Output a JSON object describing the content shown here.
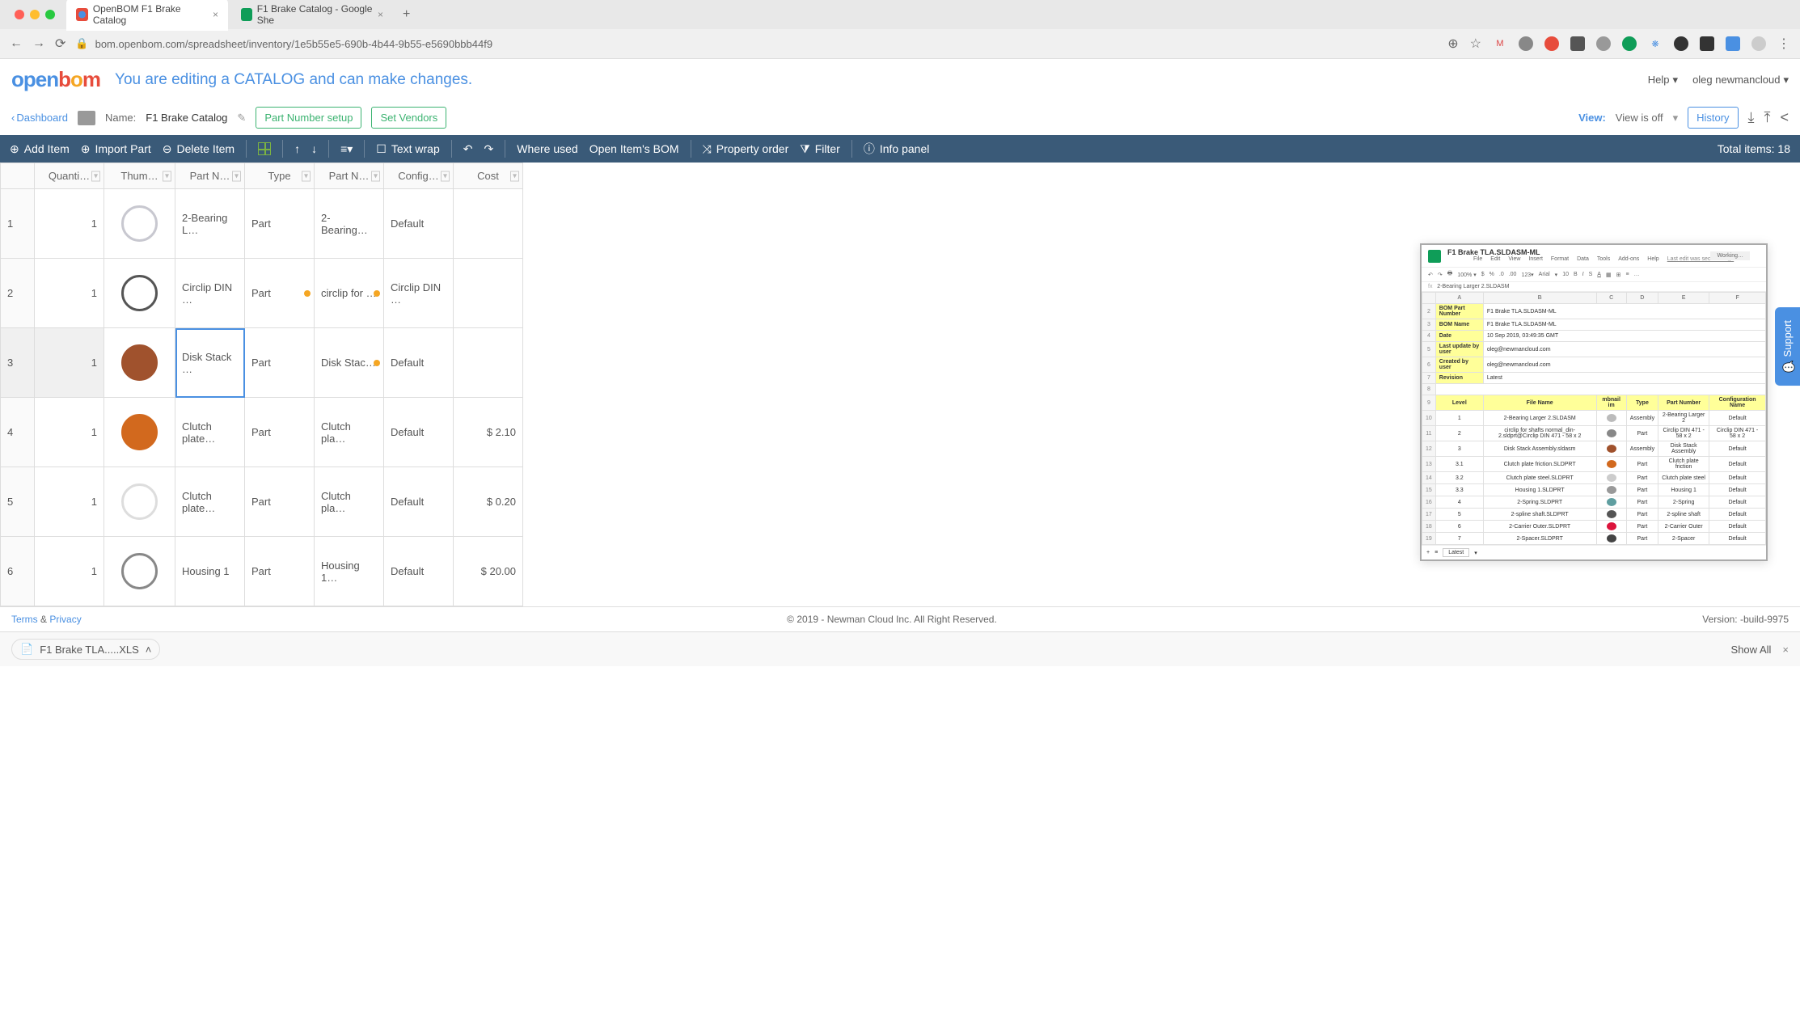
{
  "browser": {
    "tabs": [
      {
        "title": "OpenBOM F1 Brake Catalog",
        "active": true
      },
      {
        "title": "F1 Brake Catalog - Google She",
        "active": false
      }
    ],
    "url": "bom.openbom.com/spreadsheet/inventory/1e5b55e5-690b-4b44-9b55-e5690bbb44f9"
  },
  "header": {
    "logo_open": "open",
    "logo_b": "b",
    "logo_o": "o",
    "logo_m": "m",
    "notice": "You are editing a CATALOG and can make changes.",
    "help": "Help",
    "user": "oleg newmancloud"
  },
  "name_bar": {
    "dashboard": "Dashboard",
    "name_label": "Name:",
    "name_value": "F1 Brake Catalog",
    "part_number_setup": "Part Number setup",
    "set_vendors": "Set Vendors",
    "view_label": "View:",
    "view_value": "View is off",
    "history": "History"
  },
  "toolbar": {
    "add_item": "Add Item",
    "import_part": "Import Part",
    "delete_item": "Delete Item",
    "text_wrap": "Text wrap",
    "where_used": "Where used",
    "open_item_bom": "Open Item's BOM",
    "property_order": "Property order",
    "filter": "Filter",
    "info_panel": "Info panel",
    "total_items": "Total items: 18"
  },
  "table": {
    "columns": [
      "Quanti…",
      "Thum…",
      "Part N…",
      "Type",
      "Part N…",
      "Config…",
      "Cost"
    ],
    "rows": [
      {
        "num": "1",
        "qty": "1",
        "name": "2-Bearing L…",
        "type": "Part",
        "pn": "2-Bearing…",
        "cfg": "Default",
        "cost": ""
      },
      {
        "num": "2",
        "qty": "1",
        "name": "Circlip DIN …",
        "type": "Part",
        "pn": "circlip for …",
        "cfg": "Circlip DIN …",
        "cost": ""
      },
      {
        "num": "3",
        "qty": "1",
        "name": "Disk Stack …",
        "type": "Part",
        "pn": "Disk Stac…",
        "cfg": "Default",
        "cost": ""
      },
      {
        "num": "4",
        "qty": "1",
        "name": "Clutch plate…",
        "type": "Part",
        "pn": "Clutch pla…",
        "cfg": "Default",
        "cost": "$ 2.10"
      },
      {
        "num": "5",
        "qty": "1",
        "name": "Clutch plate…",
        "type": "Part",
        "pn": "Clutch pla…",
        "cfg": "Default",
        "cost": "$ 0.20"
      },
      {
        "num": "6",
        "qty": "1",
        "name": "Housing 1",
        "type": "Part",
        "pn": "Housing 1…",
        "cfg": "Default",
        "cost": "$ 20.00"
      }
    ],
    "selected": {
      "row": 2,
      "col": 2
    }
  },
  "sheets": {
    "title": "F1 Brake TLA.SLDASM-ML",
    "menu": [
      "File",
      "Edit",
      "View",
      "Insert",
      "Format",
      "Data",
      "Tools",
      "Add-ons",
      "Help"
    ],
    "last_edit": "Last edit was seconds ago",
    "working": "Working…",
    "formula_value": "2-Bearing Larger 2.SLDASM",
    "cols": [
      "A",
      "B",
      "C",
      "D",
      "E",
      "F"
    ],
    "meta": [
      {
        "k": "BOM Part Number",
        "v": "F1 Brake TLA.SLDASM-ML"
      },
      {
        "k": "BOM Name",
        "v": "F1 Brake TLA.SLDASM-ML"
      },
      {
        "k": "Date",
        "v": "10 Sep 2019, 03:49:35 GMT"
      },
      {
        "k": "Last update by user",
        "v": "oleg@newmancloud.com"
      },
      {
        "k": "Created by user",
        "v": "oleg@newmancloud.com"
      },
      {
        "k": "Revision",
        "v": "Latest"
      }
    ],
    "headers": [
      "Level",
      "File Name",
      "mbnail im",
      "Type",
      "Part Number",
      "Configuration Name"
    ],
    "rows": [
      {
        "n": "10",
        "lvl": "1",
        "fn": "2-Bearing Larger 2.SLDASM",
        "type": "Assembly",
        "pn": "2-Bearing Larger 2",
        "cfg": "Default",
        "c": "#bbb"
      },
      {
        "n": "11",
        "lvl": "2",
        "fn": "circlip for shafts normal_din-2.sldprt@Circlip DIN 471 - 58 x 2",
        "type": "Part",
        "pn": "Circlip DIN 471 - 58 x 2",
        "cfg": "Circlip DIN 471 - 58 x 2",
        "c": "#888"
      },
      {
        "n": "12",
        "lvl": "3",
        "fn": "Disk Stack Assembly.sldasm",
        "type": "Assembly",
        "pn": "Disk Stack Assembly",
        "cfg": "Default",
        "c": "#a0522d"
      },
      {
        "n": "13",
        "lvl": "3.1",
        "fn": "Clutch plate friction.SLDPRT",
        "type": "Part",
        "pn": "Clutch plate friction",
        "cfg": "Default",
        "c": "#d2691e"
      },
      {
        "n": "14",
        "lvl": "3.2",
        "fn": "Clutch plate steel.SLDPRT",
        "type": "Part",
        "pn": "Clutch plate steel",
        "cfg": "Default",
        "c": "#ccc"
      },
      {
        "n": "15",
        "lvl": "3.3",
        "fn": "Housing 1.SLDPRT",
        "type": "Part",
        "pn": "Housing 1",
        "cfg": "Default",
        "c": "#999"
      },
      {
        "n": "16",
        "lvl": "4",
        "fn": "2-Spring.SLDPRT",
        "type": "Part",
        "pn": "2-Spring",
        "cfg": "Default",
        "c": "#5f9ea0"
      },
      {
        "n": "17",
        "lvl": "5",
        "fn": "2-spline shaft.SLDPRT",
        "type": "Part",
        "pn": "2-spline shaft",
        "cfg": "Default",
        "c": "#555"
      },
      {
        "n": "18",
        "lvl": "6",
        "fn": "2-Carrier Outer.SLDPRT",
        "type": "Part",
        "pn": "2-Carrier Outer",
        "cfg": "Default",
        "c": "#dc143c"
      },
      {
        "n": "19",
        "lvl": "7",
        "fn": "2-Spacer.SLDPRT",
        "type": "Part",
        "pn": "2-Spacer",
        "cfg": "Default",
        "c": "#444"
      }
    ],
    "footer_latest": "Latest"
  },
  "support": {
    "label": "Support"
  },
  "footer": {
    "terms": "Terms",
    "amp": "&",
    "privacy": "Privacy",
    "copyright": "© 2019 - Newman Cloud Inc. All Right Reserved.",
    "version": "Version: -build-9975"
  },
  "download_bar": {
    "file": "F1 Brake TLA.....XLS",
    "show_all": "Show All"
  },
  "thumb_colors": [
    "#c8c8d0",
    "#555",
    "#a0522d",
    "#d2691e",
    "#ddd",
    "#888"
  ]
}
